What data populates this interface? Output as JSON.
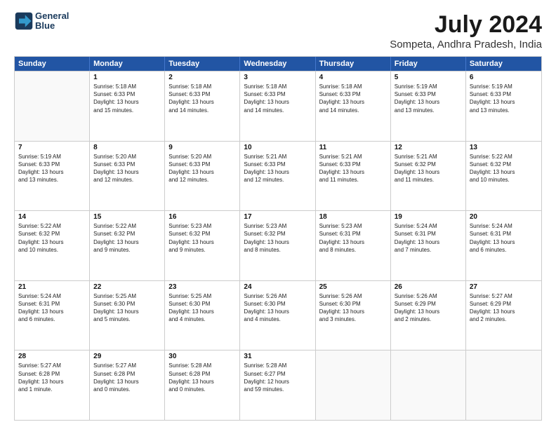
{
  "logo": {
    "line1": "General",
    "line2": "Blue"
  },
  "title": "July 2024",
  "subtitle": "Sompeta, Andhra Pradesh, India",
  "header_days": [
    "Sunday",
    "Monday",
    "Tuesday",
    "Wednesday",
    "Thursday",
    "Friday",
    "Saturday"
  ],
  "weeks": [
    [
      {
        "day": "",
        "text": ""
      },
      {
        "day": "1",
        "text": "Sunrise: 5:18 AM\nSunset: 6:33 PM\nDaylight: 13 hours\nand 15 minutes."
      },
      {
        "day": "2",
        "text": "Sunrise: 5:18 AM\nSunset: 6:33 PM\nDaylight: 13 hours\nand 14 minutes."
      },
      {
        "day": "3",
        "text": "Sunrise: 5:18 AM\nSunset: 6:33 PM\nDaylight: 13 hours\nand 14 minutes."
      },
      {
        "day": "4",
        "text": "Sunrise: 5:18 AM\nSunset: 6:33 PM\nDaylight: 13 hours\nand 14 minutes."
      },
      {
        "day": "5",
        "text": "Sunrise: 5:19 AM\nSunset: 6:33 PM\nDaylight: 13 hours\nand 13 minutes."
      },
      {
        "day": "6",
        "text": "Sunrise: 5:19 AM\nSunset: 6:33 PM\nDaylight: 13 hours\nand 13 minutes."
      }
    ],
    [
      {
        "day": "7",
        "text": "Sunrise: 5:19 AM\nSunset: 6:33 PM\nDaylight: 13 hours\nand 13 minutes."
      },
      {
        "day": "8",
        "text": "Sunrise: 5:20 AM\nSunset: 6:33 PM\nDaylight: 13 hours\nand 12 minutes."
      },
      {
        "day": "9",
        "text": "Sunrise: 5:20 AM\nSunset: 6:33 PM\nDaylight: 13 hours\nand 12 minutes."
      },
      {
        "day": "10",
        "text": "Sunrise: 5:21 AM\nSunset: 6:33 PM\nDaylight: 13 hours\nand 12 minutes."
      },
      {
        "day": "11",
        "text": "Sunrise: 5:21 AM\nSunset: 6:33 PM\nDaylight: 13 hours\nand 11 minutes."
      },
      {
        "day": "12",
        "text": "Sunrise: 5:21 AM\nSunset: 6:32 PM\nDaylight: 13 hours\nand 11 minutes."
      },
      {
        "day": "13",
        "text": "Sunrise: 5:22 AM\nSunset: 6:32 PM\nDaylight: 13 hours\nand 10 minutes."
      }
    ],
    [
      {
        "day": "14",
        "text": "Sunrise: 5:22 AM\nSunset: 6:32 PM\nDaylight: 13 hours\nand 10 minutes."
      },
      {
        "day": "15",
        "text": "Sunrise: 5:22 AM\nSunset: 6:32 PM\nDaylight: 13 hours\nand 9 minutes."
      },
      {
        "day": "16",
        "text": "Sunrise: 5:23 AM\nSunset: 6:32 PM\nDaylight: 13 hours\nand 9 minutes."
      },
      {
        "day": "17",
        "text": "Sunrise: 5:23 AM\nSunset: 6:32 PM\nDaylight: 13 hours\nand 8 minutes."
      },
      {
        "day": "18",
        "text": "Sunrise: 5:23 AM\nSunset: 6:31 PM\nDaylight: 13 hours\nand 8 minutes."
      },
      {
        "day": "19",
        "text": "Sunrise: 5:24 AM\nSunset: 6:31 PM\nDaylight: 13 hours\nand 7 minutes."
      },
      {
        "day": "20",
        "text": "Sunrise: 5:24 AM\nSunset: 6:31 PM\nDaylight: 13 hours\nand 6 minutes."
      }
    ],
    [
      {
        "day": "21",
        "text": "Sunrise: 5:24 AM\nSunset: 6:31 PM\nDaylight: 13 hours\nand 6 minutes."
      },
      {
        "day": "22",
        "text": "Sunrise: 5:25 AM\nSunset: 6:30 PM\nDaylight: 13 hours\nand 5 minutes."
      },
      {
        "day": "23",
        "text": "Sunrise: 5:25 AM\nSunset: 6:30 PM\nDaylight: 13 hours\nand 4 minutes."
      },
      {
        "day": "24",
        "text": "Sunrise: 5:26 AM\nSunset: 6:30 PM\nDaylight: 13 hours\nand 4 minutes."
      },
      {
        "day": "25",
        "text": "Sunrise: 5:26 AM\nSunset: 6:30 PM\nDaylight: 13 hours\nand 3 minutes."
      },
      {
        "day": "26",
        "text": "Sunrise: 5:26 AM\nSunset: 6:29 PM\nDaylight: 13 hours\nand 2 minutes."
      },
      {
        "day": "27",
        "text": "Sunrise: 5:27 AM\nSunset: 6:29 PM\nDaylight: 13 hours\nand 2 minutes."
      }
    ],
    [
      {
        "day": "28",
        "text": "Sunrise: 5:27 AM\nSunset: 6:28 PM\nDaylight: 13 hours\nand 1 minute."
      },
      {
        "day": "29",
        "text": "Sunrise: 5:27 AM\nSunset: 6:28 PM\nDaylight: 13 hours\nand 0 minutes."
      },
      {
        "day": "30",
        "text": "Sunrise: 5:28 AM\nSunset: 6:28 PM\nDaylight: 13 hours\nand 0 minutes."
      },
      {
        "day": "31",
        "text": "Sunrise: 5:28 AM\nSunset: 6:27 PM\nDaylight: 12 hours\nand 59 minutes."
      },
      {
        "day": "",
        "text": ""
      },
      {
        "day": "",
        "text": ""
      },
      {
        "day": "",
        "text": ""
      }
    ]
  ]
}
